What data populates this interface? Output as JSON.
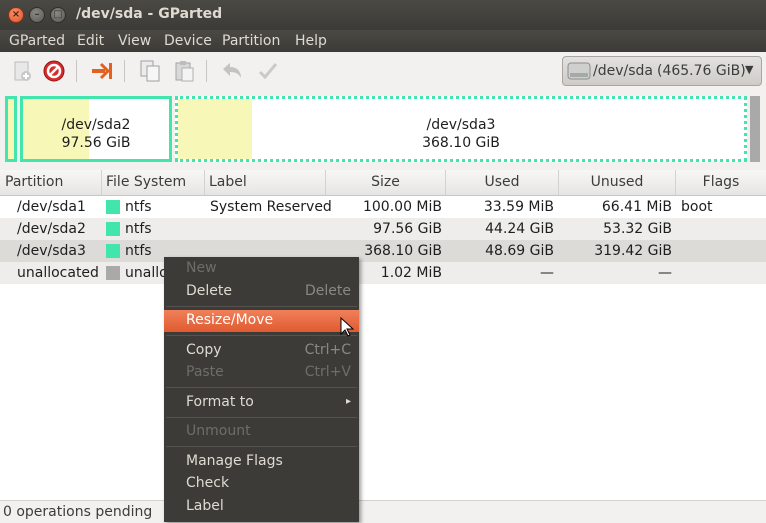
{
  "window": {
    "title": "/dev/sda - GParted"
  },
  "menubar": [
    "GParted",
    "Edit",
    "View",
    "Device",
    "Partition",
    "Help"
  ],
  "toolbar": {
    "icons": [
      "new-partition-icon",
      "delete-icon",
      "apply-resize-icon",
      "copy-icon",
      "paste-icon",
      "undo-icon",
      "apply-icon"
    ],
    "device": {
      "name": "/dev/sda",
      "size": "(465.76 GiB)"
    }
  },
  "partition_map": {
    "sda2": {
      "name": "/dev/sda2",
      "size": "97.56 GiB",
      "used_fraction": 0.45
    },
    "sda3": {
      "name": "/dev/sda3",
      "size": "368.10 GiB",
      "used_fraction": 0.13
    }
  },
  "table": {
    "headers": [
      "Partition",
      "File System",
      "Label",
      "Size",
      "Used",
      "Unused",
      "Flags"
    ],
    "rows": [
      {
        "partition": "/dev/sda1",
        "fs": "ntfs",
        "fs_color": "#42e5ac",
        "label": "System Reserved",
        "size": "100.00 MiB",
        "used": "33.59 MiB",
        "unused": "66.41 MiB",
        "flags": "boot"
      },
      {
        "partition": "/dev/sda2",
        "fs": "ntfs",
        "fs_color": "#42e5ac",
        "label": "",
        "size": "97.56 GiB",
        "used": "44.24 GiB",
        "unused": "53.32 GiB",
        "flags": ""
      },
      {
        "partition": "/dev/sda3",
        "fs": "ntfs",
        "fs_color": "#42e5ac",
        "label": "",
        "size": "368.10 GiB",
        "used": "48.69 GiB",
        "unused": "319.42 GiB",
        "flags": ""
      },
      {
        "partition": "unallocated",
        "fs": "unallo",
        "fs_color": "#a9a9a9",
        "label": "",
        "size": "1.02 MiB",
        "used": "—",
        "unused": "—",
        "flags": ""
      }
    ]
  },
  "context_menu": {
    "new": "New",
    "delete": "Delete",
    "delete_shortcut": "Delete",
    "resize": "Resize/Move",
    "copy": "Copy",
    "copy_shortcut": "Ctrl+C",
    "paste": "Paste",
    "paste_shortcut": "Ctrl+V",
    "format": "Format to",
    "unmount": "Unmount",
    "manage_flags": "Manage Flags",
    "check": "Check",
    "label": "Label"
  },
  "status": {
    "text": "0 operations pending"
  },
  "colors": {
    "ntfs": "#42e5ac",
    "unallocated": "#a9a9a9",
    "highlight": "#e96a3f",
    "used": "#f7f7b8"
  }
}
